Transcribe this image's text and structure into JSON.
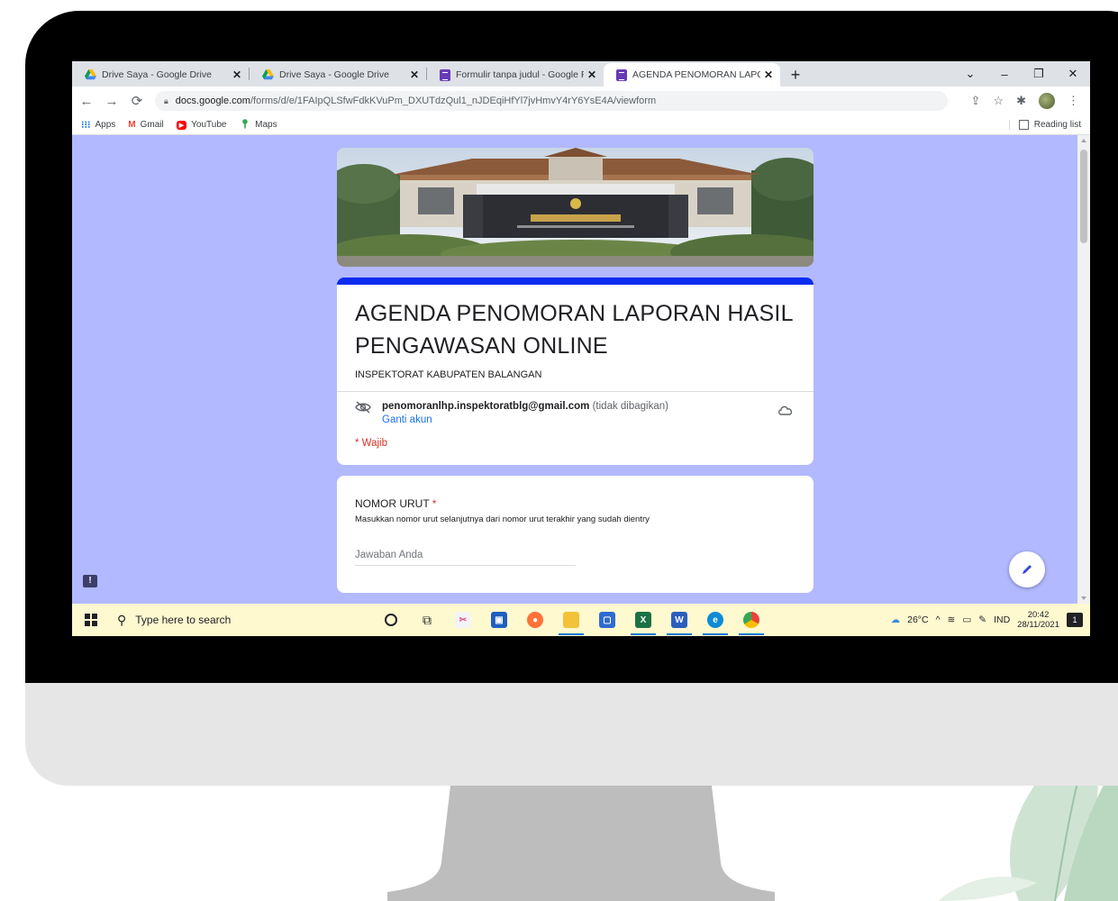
{
  "browser": {
    "tabs": [
      {
        "title": "Drive Saya - Google Drive",
        "icon": "google-drive-icon",
        "active": false
      },
      {
        "title": "Drive Saya - Google Drive",
        "icon": "google-drive-icon",
        "active": false
      },
      {
        "title": "Formulir tanpa judul - Google Fo",
        "icon": "google-forms-icon",
        "active": false
      },
      {
        "title": "AGENDA PENOMORAN LAPORA",
        "icon": "google-forms-icon",
        "active": true
      }
    ],
    "new_tab": "+",
    "url_host": "docs.google.com",
    "url_path": "/forms/d/e/1FAIpQLSfwFdkKVuPm_DXUTdzQul1_nJDEqiHfYl7jvHmvY4rY6YsE4A/viewform",
    "bookmarks": [
      {
        "label": "Apps",
        "icon": "apps-grid-icon"
      },
      {
        "label": "Gmail",
        "icon": "gmail-icon"
      },
      {
        "label": "YouTube",
        "icon": "youtube-icon"
      },
      {
        "label": "Maps",
        "icon": "maps-icon"
      }
    ],
    "reading_list": "Reading list"
  },
  "form": {
    "title": "AGENDA PENOMORAN LAPORAN HASIL PENGAWASAN ONLINE",
    "description": "INSPEKTORAT KABUPATEN BALANGAN",
    "account_email": "penomoranlhp.inspektoratblg@gmail.com",
    "account_shared": "(tidak dibagikan)",
    "switch_account": "Ganti akun",
    "required_note": "* Wajib",
    "question": {
      "title": "NOMOR URUT",
      "required_mark": "*",
      "help": "Masukkan nomor urut selanjutnya dari nomor urut terakhir yang sudah dientry",
      "placeholder": "Jawaban Anda"
    }
  },
  "taskbar": {
    "search_placeholder": "Type here to search",
    "weather": "26°C",
    "language": "IND",
    "time": "20:42",
    "date": "28/11/2021",
    "notification_count": "1"
  },
  "colors": {
    "form_background": "#b2b9ff",
    "form_accent": "#0c2cf0",
    "required": "#d93025",
    "link": "#1a73e8",
    "taskbar": "#fff9d0"
  }
}
